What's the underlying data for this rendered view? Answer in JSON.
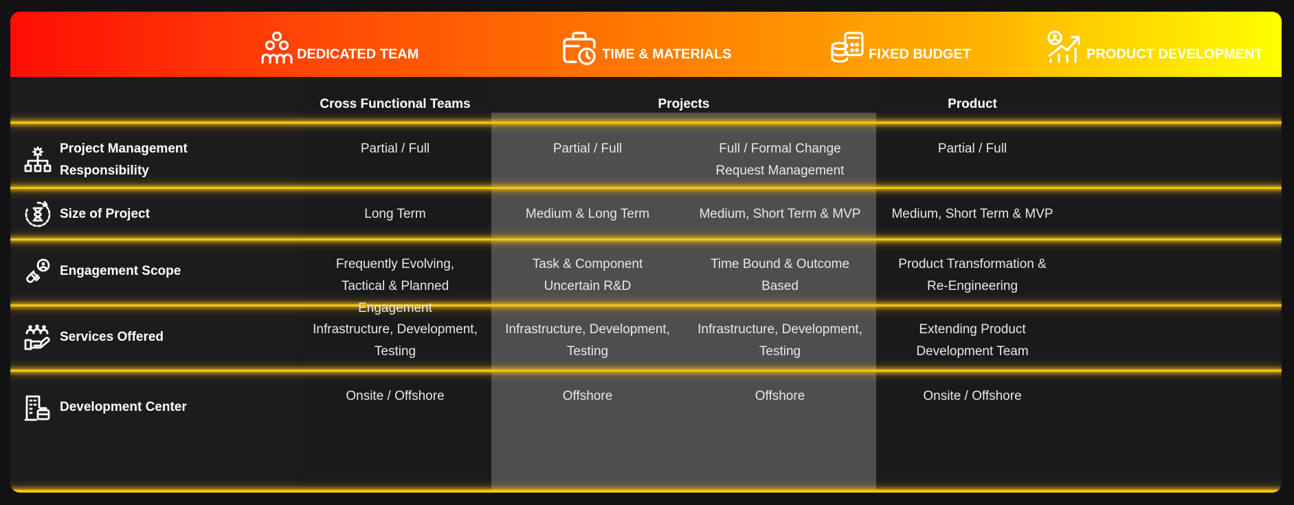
{
  "models": [
    {
      "label": "DEDICATED TEAM",
      "icon": "team-icon"
    },
    {
      "label": "TIME & MATERIALS",
      "icon": "briefcase-clock-icon"
    },
    {
      "label": "FIXED BUDGET",
      "icon": "coins-calculator-icon"
    },
    {
      "label": "PRODUCT DEVELOPMENT",
      "icon": "growth-chart-icon"
    }
  ],
  "column_headers": {
    "cross_functional": "Cross Functional Teams",
    "projects": "Projects",
    "product": "Product"
  },
  "rows": [
    {
      "label": "Project Management Responsibility",
      "icon": "org-chart-gear-icon",
      "cells": [
        "Partial / Full",
        "Partial / Full",
        "Full / Formal Change Request Management",
        "Partial / Full"
      ]
    },
    {
      "label": "Size of Project",
      "icon": "hourglass-cycle-icon",
      "cells": [
        "Long Term",
        "Medium & Long Term",
        "Medium, Short Term & MVP",
        "Medium, Short Term & MVP"
      ]
    },
    {
      "label": "Engagement Scope",
      "icon": "handshake-user-icon",
      "cells": [
        "Frequently Evolving, Tactical & Planned Engagement",
        "Task & Component Uncertain R&D",
        "Time Bound & Outcome Based",
        "Product Transformation & Re-Engineering"
      ]
    },
    {
      "label": "Services Offered",
      "icon": "team-hand-icon",
      "cells": [
        "Infrastructure, Development, Testing",
        "Infrastructure, Development, Testing",
        "Infrastructure, Development, Testing",
        "Extending Product Development Team"
      ]
    },
    {
      "label": "Development Center",
      "icon": "office-building-icon",
      "cells": [
        "Onsite / Offshore",
        "Offshore",
        "Offshore",
        "Onsite / Offshore"
      ]
    }
  ],
  "colors": {
    "gradient_start": "#ff0d05",
    "gradient_end": "#ffff00",
    "separator": "#f4c414",
    "highlight_column": "#4e4e4e",
    "background": "#1b1b1e"
  }
}
